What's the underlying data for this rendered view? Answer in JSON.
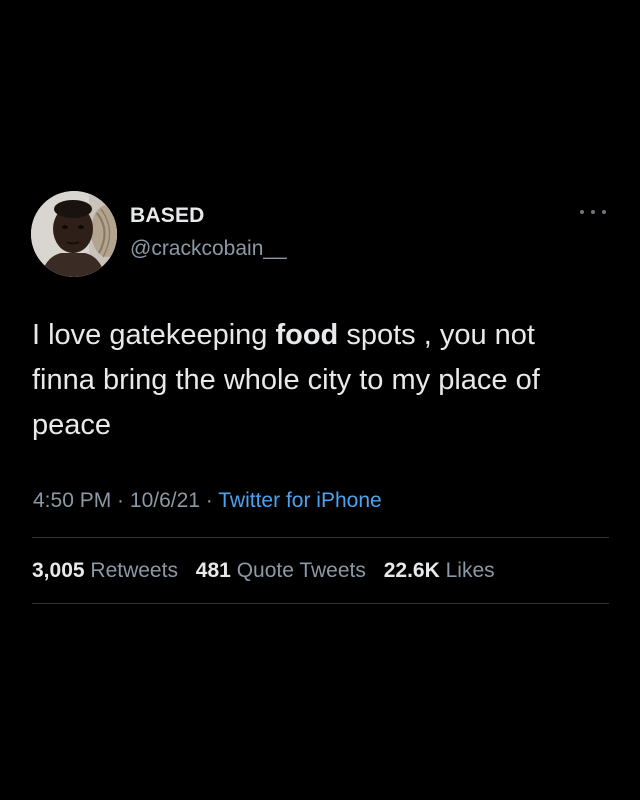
{
  "tweet": {
    "display_name": "BASED",
    "handle": "@crackcobain__",
    "more_icon": "more-horizontal-icon",
    "text_parts": [
      "I love gatekeeping ",
      "food",
      " spots , you not finna bring the whole city to my place of peace"
    ],
    "time": "4:50 PM",
    "sep1": " · ",
    "date": "10/6/21",
    "sep2": " · ",
    "source": "Twitter for iPhone"
  },
  "stats": {
    "retweets_count": "3,005",
    "retweets_label": "Retweets",
    "quotes_count": "481",
    "quotes_label": "Quote Tweets",
    "likes_count": "22.6K",
    "likes_label": "Likes"
  },
  "colors": {
    "background": "#000000",
    "text_primary": "#e7e9ea",
    "text_secondary": "#8b98a5",
    "link": "#4aa3ef",
    "divider": "#2f3336"
  }
}
